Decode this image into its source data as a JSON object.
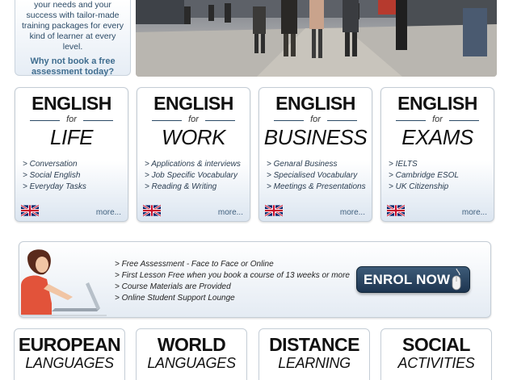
{
  "intro": {
    "description": "your needs and your success with tailor-made training packages for every kind of learner at every level.",
    "cta": "Why not book a free assessment today?"
  },
  "cards": [
    {
      "title": "ENGLISH",
      "for": "for",
      "subtitle": "LIFE",
      "items": [
        "> Conversation",
        "> Social English",
        "> Everyday Tasks"
      ],
      "more": "more..."
    },
    {
      "title": "ENGLISH",
      "for": "for",
      "subtitle": "WORK",
      "items": [
        "> Applications & interviews",
        "> Job Specific Vocabulary",
        "> Reading & Writing"
      ],
      "more": "more..."
    },
    {
      "title": "ENGLISH",
      "for": "for",
      "subtitle": "BUSINESS",
      "items": [
        "> Genaral Business",
        "> Specialised Vocabulary",
        "> Meetings & Presentations"
      ],
      "more": "more..."
    },
    {
      "title": "ENGLISH",
      "for": "for",
      "subtitle": "EXAMS",
      "items": [
        "> IELTS",
        "> Cambridge ESOL",
        "> UK Citizenship"
      ],
      "more": "more..."
    }
  ],
  "enrol": {
    "items": [
      "> Free Assessment - Face to Face or Online",
      "> First Lesson Free when you book a course of 13 weeks or more",
      "> Course Materials are Provided",
      "> Online Student Support Lounge"
    ],
    "button": "ENROL NOW"
  },
  "categories": [
    {
      "line1": "EUROPEAN",
      "line2": "LANGUAGES"
    },
    {
      "line1": "WORLD",
      "line2": "LANGUAGES"
    },
    {
      "line1": "DISTANCE",
      "line2": "LEARNING"
    },
    {
      "line1": "SOCIAL",
      "line2": "ACTIVITIES"
    }
  ],
  "colors": {
    "accent": "#2b4a66",
    "button": "#1d3550",
    "flag_blue": "#012169",
    "flag_red": "#C8102E"
  }
}
